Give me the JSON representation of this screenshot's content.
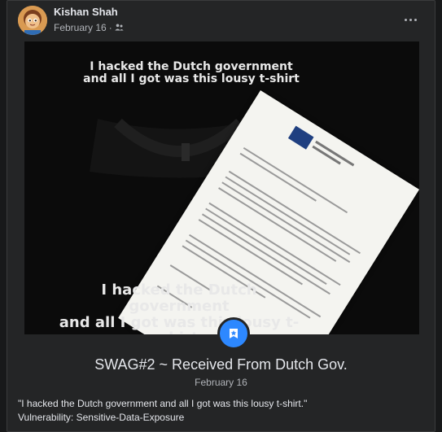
{
  "post": {
    "author": "Kishan Shah",
    "date": "February 16",
    "meta_separator": "·",
    "privacy_icon": "friends-icon",
    "more_icon": "more-options-icon"
  },
  "photo": {
    "shirt_text_top_line1": "I hacked the Dutch government",
    "shirt_text_top_line2": "and all I got was this lousy t-shirt",
    "shirt_text_bottom_line1": "I hacked the Dutch government",
    "shirt_text_bottom_line2": "and all I got was this lousy t-shirt"
  },
  "badge": {
    "icon": "star-badge-icon"
  },
  "event": {
    "title": "SWAG#2 ~ Received From Dutch Gov.",
    "date": "February 16",
    "description_line1": "\"I hacked the Dutch government and all I got was this lousy t-shirt.\"",
    "description_line2": "Vulnerability: Sensitive-Data-Exposure"
  },
  "colors": {
    "background": "#18191a",
    "card": "#242526",
    "accent": "#2d88ff",
    "text_primary": "#e4e6eb",
    "text_secondary": "#b0b3b8"
  }
}
